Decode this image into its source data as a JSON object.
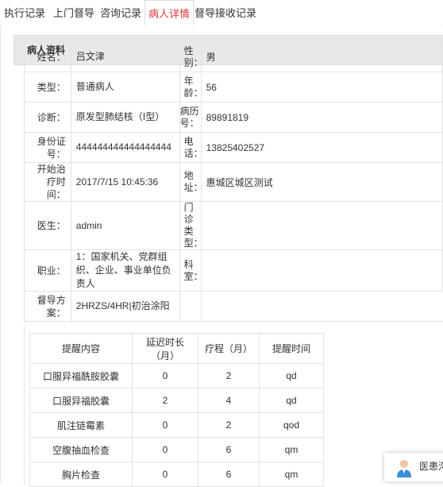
{
  "tabs": [
    "执行记录",
    "上门督导",
    "咨询记录",
    "病人详情",
    "督导接收记录"
  ],
  "active_tab": 3,
  "panel": {
    "title": "病人资料"
  },
  "patient": {
    "name_label": "姓名：",
    "name": "吕文津",
    "gender_label": "性别：",
    "gender": "男",
    "type_label": "类型：",
    "type": "普通病人",
    "age_label": "年龄：",
    "age": "56",
    "diagnosis_label": "诊断：",
    "diagnosis": "原发型肺结核（Ⅰ型）",
    "record_label": "病历号：",
    "record_no": "89891819",
    "id_label": "身份证号：",
    "id_no": "444444444444444444",
    "phone_label": "电话：",
    "phone": "13825402527",
    "start_label": "开始治疗时间：",
    "start_time": "2017/7/15 10:45:36",
    "address_label": "地址：",
    "address": "惠城区城区测试",
    "doctor_label": "医生：",
    "doctor": "admin",
    "clinic_label": "门诊类型：",
    "clinic_type": "",
    "job_label": "职业：",
    "job": "1：国家机关、党群组织、企业、事业单位负责人",
    "dept_label": "科室：",
    "dept": "",
    "plan_label": "督导方案：",
    "plan": "2HRZS/4HR|初治涂阳"
  },
  "reminders": {
    "headers": [
      "提醒内容",
      "延迟时长（月）",
      "疗程（月）",
      "提醒时间"
    ],
    "rows": [
      [
        "口服异福酰胺胶囊",
        "0",
        "2",
        "qd"
      ],
      [
        "口服异福胶囊",
        "2",
        "4",
        "qd"
      ],
      [
        "肌注链霉素",
        "0",
        "2",
        "qod"
      ],
      [
        "空腹抽血检查",
        "0",
        "6",
        "qm"
      ],
      [
        "胸片检查",
        "0",
        "6",
        "qm"
      ]
    ]
  },
  "chat": {
    "label": "医患沟通"
  }
}
